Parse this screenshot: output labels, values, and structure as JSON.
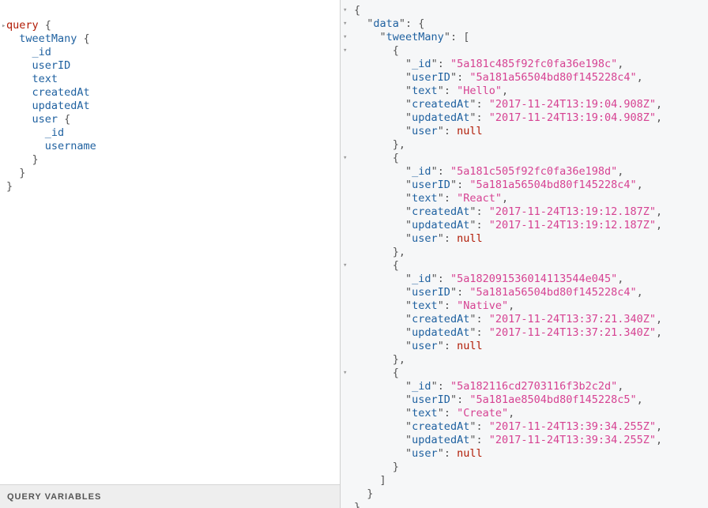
{
  "query_editor": {
    "lines": [
      {
        "indent": "",
        "text": "query",
        "suffix": " {"
      },
      {
        "indent": "  ",
        "text": "tweetMany",
        "suffix": " {"
      },
      {
        "indent": "    ",
        "text": "_id",
        "suffix": ""
      },
      {
        "indent": "    ",
        "text": "userID",
        "suffix": ""
      },
      {
        "indent": "    ",
        "text": "text",
        "suffix": ""
      },
      {
        "indent": "    ",
        "text": "createdAt",
        "suffix": ""
      },
      {
        "indent": "    ",
        "text": "updatedAt",
        "suffix": ""
      },
      {
        "indent": "    ",
        "text": "user",
        "suffix": " {"
      },
      {
        "indent": "      ",
        "text": "_id",
        "suffix": ""
      },
      {
        "indent": "      ",
        "text": "username",
        "suffix": ""
      },
      {
        "indent": "    ",
        "text": "",
        "suffix": "}"
      },
      {
        "indent": "  ",
        "text": "",
        "suffix": "}"
      },
      {
        "indent": "",
        "text": "",
        "suffix": "}"
      }
    ]
  },
  "query_variables": {
    "label": "QUERY VARIABLES"
  },
  "result": {
    "data_key": "data",
    "list_key": "tweetMany",
    "null_value": "null",
    "tweets": [
      {
        "_id": "5a181c485f92fc0fa36e198c",
        "userID": "5a181a56504bd80f145228c4",
        "text": "Hello",
        "createdAt": "2017-11-24T13:19:04.908Z",
        "updatedAt": "2017-11-24T13:19:04.908Z"
      },
      {
        "_id": "5a181c505f92fc0fa36e198d",
        "userID": "5a181a56504bd80f145228c4",
        "text": "React",
        "createdAt": "2017-11-24T13:19:12.187Z",
        "updatedAt": "2017-11-24T13:19:12.187Z"
      },
      {
        "_id": "5a182091536014113544e045",
        "userID": "5a181a56504bd80f145228c4",
        "text": "Native",
        "createdAt": "2017-11-24T13:37:21.340Z",
        "updatedAt": "2017-11-24T13:37:21.340Z"
      },
      {
        "_id": "5a182116cd2703116f3b2c2d",
        "userID": "5a181ae8504bd80f145228c5",
        "text": "Create",
        "createdAt": "2017-11-24T13:39:34.255Z",
        "updatedAt": "2017-11-24T13:39:34.255Z"
      }
    ]
  }
}
